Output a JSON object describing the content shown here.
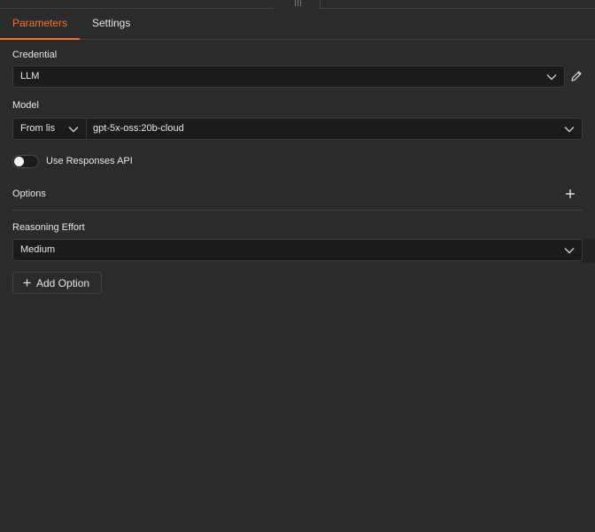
{
  "tabs": {
    "parameters": "Parameters",
    "settings": "Settings"
  },
  "credential": {
    "label": "Credential",
    "value": "LLM"
  },
  "model": {
    "label": "Model",
    "mode": "From lis",
    "value": "gpt-5x-oss:20b-cloud"
  },
  "responses_api": {
    "label": "Use Responses API",
    "enabled": false
  },
  "options": {
    "label": "Options"
  },
  "reasoning_effort": {
    "label": "Reasoning Effort",
    "value": "Medium"
  },
  "add_option": {
    "label": "Add Option"
  },
  "colors": {
    "accent": "#ff6d2d",
    "background": "#2b2b2b",
    "input_background": "#1b1b1b"
  }
}
